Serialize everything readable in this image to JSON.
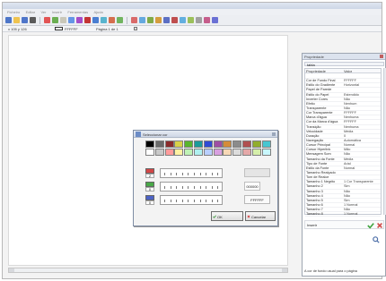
{
  "window": {
    "title": "",
    "menu": [
      "Ficheiro",
      "Editar",
      "Ver",
      "Inserir",
      "Ferramentas",
      "Ajuda"
    ]
  },
  "statusbar": {
    "coords": "x 105 y 126",
    "color_hex": "FFFFFF",
    "pages": "Página 1 de 1"
  },
  "inspector": {
    "name": "tabla",
    "header_property": "Propriedade",
    "header_value": "Valor",
    "footer_label": "Inserir",
    "description": "A cor de fundo usual para o página",
    "properties": [
      {
        "key": "",
        "value": ""
      },
      {
        "key": "Cor de Fundo Final",
        "value": "FFFFFF"
      },
      {
        "key": "Estilo do Gradiente",
        "value": "Horizontal"
      },
      {
        "key": "Papel de Parede",
        "value": ""
      },
      {
        "key": "Estilo do Papel",
        "value": "Estendido"
      },
      {
        "key": "Inverter Cores",
        "value": "Não"
      },
      {
        "key": "Efeito",
        "value": "Nenhum"
      },
      {
        "key": "Transparente",
        "value": "Não"
      },
      {
        "key": "Cor Transparente",
        "value": "FFFFFF"
      },
      {
        "key": "Marca d'água",
        "value": "Nenhuma"
      },
      {
        "key": "Cor da Marca d'água",
        "value": "FFFFFF"
      },
      {
        "key": "Transição",
        "value": "Nenhuma"
      },
      {
        "key": "Velocidade",
        "value": "Média"
      },
      {
        "key": "Duração",
        "value": "0"
      },
      {
        "key": "Navegação",
        "value": "Automática"
      },
      {
        "key": "Cursor Principal",
        "value": "Normal"
      },
      {
        "key": "Cursor Hiperlink",
        "value": "Mão"
      },
      {
        "key": "Mensagem Som",
        "value": "Não"
      },
      {
        "key": "Tamanho da Fonte",
        "value": "Média"
      },
      {
        "key": "Tipo de Fonte",
        "value": "Arial"
      },
      {
        "key": "Estilo da Fonte",
        "value": "Normal"
      },
      {
        "key": "Tamanho Realçado",
        "value": ""
      },
      {
        "key": "Tom de Realce",
        "value": ""
      },
      {
        "key": "Tamanho 1 Negrito",
        "value": "1 Cor Transparente"
      },
      {
        "key": "Tamanho 2",
        "value": "Sim"
      },
      {
        "key": "Tamanho 3",
        "value": "Não"
      },
      {
        "key": "Tamanho 4",
        "value": "Não"
      },
      {
        "key": "Tamanho 5",
        "value": "Sim"
      },
      {
        "key": "Tamanho 6",
        "value": "1 Normal"
      },
      {
        "key": "Tamanho 7",
        "value": "Não"
      },
      {
        "key": "Tamanho 8",
        "value": "1 Normal"
      }
    ]
  },
  "dialog": {
    "title": "Seleccionar cor",
    "channel_values": [
      "2",
      "0",
      "0"
    ],
    "hex_text": "FFFFFF",
    "preview_text": "000000",
    "ok_label": "OK",
    "cancel_label": "Cancelar"
  },
  "colors": {
    "red": "#d24646",
    "green": "#48a847",
    "blue": "#4d63c6",
    "palette": [
      "#000000",
      "#6b6b6b",
      "#8a2b2b",
      "#d8d148",
      "#59b52d",
      "#1b9b9b",
      "#2f4bd5",
      "#9e4ea4",
      "#d48c39",
      "#8b8b8b",
      "#b05050",
      "#91ad2d",
      "#47c6d1",
      "#ffffff",
      "#c8c8c8",
      "#ff9b9b",
      "#fff2a2",
      "#bff2b5",
      "#aff0ef",
      "#b9cfff",
      "#d8a0e0",
      "#f7d8b6",
      "#dcdcdc",
      "#e5a9a9",
      "#d5efaa",
      "#c8f7fd"
    ]
  }
}
